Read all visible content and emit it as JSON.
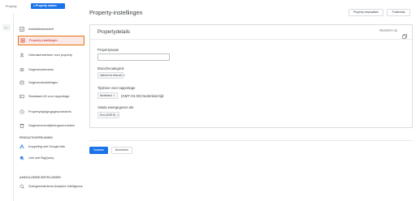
{
  "topbar": {
    "property_label": "Property",
    "property_selector": "● Property maken"
  },
  "header": {
    "title": "Property-instellingen",
    "move_button": "Property verplaatsen",
    "trash_button": "Prullenbak"
  },
  "sidebar": {
    "items": [
      {
        "label": "Installatieassistent",
        "icon": "checklist-icon"
      },
      {
        "label": "Property-instellingen",
        "icon": "settings-icon",
        "active": true
      },
      {
        "label": "Gebruikersbeheer voor property",
        "icon": "users-icon"
      },
      {
        "label": "Gegevensstreams",
        "icon": "streams-icon"
      },
      {
        "label": "Gegevensinstellingen",
        "icon": "database-icon"
      },
      {
        "label": "Standaard-ID voor rapportage",
        "icon": "id-icon"
      },
      {
        "label": "Propertywijzigingsgeschiedenis",
        "icon": "history-icon"
      },
      {
        "label": "Gegevensverwijderingsverzoeken",
        "icon": "delete-data-icon"
      }
    ],
    "section_products": "PRODUCTKOPPELINGEN",
    "products": [
      {
        "label": "Koppeling met Google Ads",
        "icon": "google-ads-icon"
      },
      {
        "label": "Link met BigQuery",
        "icon": "bigquery-icon"
      }
    ],
    "section_extra": "AANVULLENDE INSTELLINGEN",
    "extra": [
      {
        "label": "Zoekgeschiedenis Analytics Intelligence",
        "icon": "search-history-icon"
      }
    ]
  },
  "card": {
    "title": "Propertydetails",
    "property_id_label": "PROPERTY-ID",
    "property_name_label": "Propertynaam",
    "property_name_value": "",
    "industry_label": "Branchecategorie",
    "industry_value": "Internet en telecom",
    "timezone_label": "Tijdzone voor rapportage",
    "timezone_country": "Nederland",
    "timezone_value": "(GMT+01:00) Nederland-tijd",
    "currency_label": "Valuta weergegeven als",
    "currency_value": "Euro (EUR €)"
  },
  "footer": {
    "save": "Opslaan",
    "cancel": "Annuleren"
  },
  "colors": {
    "accent": "#1a73e8",
    "active_border": "#e8710a",
    "active_bg": "#fbe9e7"
  }
}
